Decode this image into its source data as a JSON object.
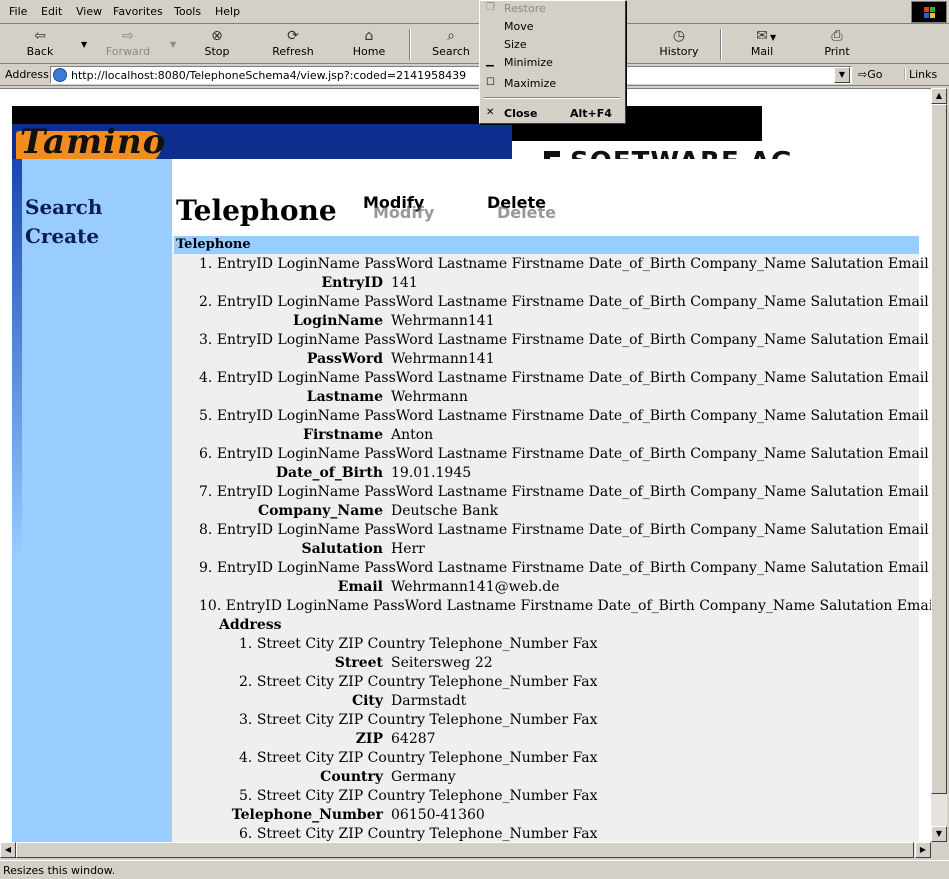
{
  "menubar": {
    "items": [
      "File",
      "Edit",
      "View",
      "Favorites",
      "Tools",
      "Help"
    ]
  },
  "toolbar": {
    "back": "Back",
    "forward": "Forward",
    "stop": "Stop",
    "refresh": "Refresh",
    "home": "Home",
    "search": "Search",
    "history": "History",
    "mail": "Mail",
    "print": "Print"
  },
  "address": {
    "label": "Address",
    "url": "http://localhost:8080/TelephoneSchema4/view.jsp?:coded=2141958439",
    "go": "Go",
    "links": "Links"
  },
  "system_menu": {
    "restore": "Restore",
    "move": "Move",
    "size": "Size",
    "minimize": "Minimize",
    "maximize": "Maximize",
    "close": "Close",
    "close_shortcut": "Alt+F4"
  },
  "page": {
    "logo_text": "Tamino",
    "brand_text": "SOFTWARE AG",
    "sidebar": {
      "search": "Search",
      "create": "Create"
    },
    "title": "Telephone",
    "actions": {
      "modify": "Modify",
      "delete": "Delete"
    },
    "section_label": "Telephone",
    "entries": [
      {
        "num": "1.",
        "header": "EntryID LoginName PassWord Lastname Firstname Date_of_Birth Company_Name Salutation Email Address",
        "label": "EntryID",
        "value": "141"
      },
      {
        "num": "2.",
        "header": "EntryID LoginName PassWord Lastname Firstname Date_of_Birth Company_Name Salutation Email Address",
        "label": "LoginName",
        "value": "Wehrmann141"
      },
      {
        "num": "3.",
        "header": "EntryID LoginName PassWord Lastname Firstname Date_of_Birth Company_Name Salutation Email Address",
        "label": "PassWord",
        "value": "Wehrmann141"
      },
      {
        "num": "4.",
        "header": "EntryID LoginName PassWord Lastname Firstname Date_of_Birth Company_Name Salutation Email Address",
        "label": "Lastname",
        "value": "Wehrmann"
      },
      {
        "num": "5.",
        "header": "EntryID LoginName PassWord Lastname Firstname Date_of_Birth Company_Name Salutation Email Address",
        "label": "Firstname",
        "value": "Anton"
      },
      {
        "num": "6.",
        "header": "EntryID LoginName PassWord Lastname Firstname Date_of_Birth Company_Name Salutation Email Address",
        "label": "Date_of_Birth",
        "value": "19.01.1945"
      },
      {
        "num": "7.",
        "header": "EntryID LoginName PassWord Lastname Firstname Date_of_Birth Company_Name Salutation Email Address",
        "label": "Company_Name",
        "value": "Deutsche Bank"
      },
      {
        "num": "8.",
        "header": "EntryID LoginName PassWord Lastname Firstname Date_of_Birth Company_Name Salutation Email Address",
        "label": "Salutation",
        "value": "Herr"
      },
      {
        "num": "9.",
        "header": "EntryID LoginName PassWord Lastname Firstname Date_of_Birth Company_Name Salutation Email Address",
        "label": "Email",
        "value": "Wehrmann141@web.de"
      },
      {
        "num": "10.",
        "header": "EntryID LoginName PassWord Lastname Firstname Date_of_Birth Company_Name Salutation Email Address",
        "label": "Address",
        "value": ""
      }
    ],
    "address_entries": [
      {
        "num": "1.",
        "header": "Street City ZIP Country Telephone_Number Fax",
        "label": "Street",
        "value": "Seitersweg 22"
      },
      {
        "num": "2.",
        "header": "Street City ZIP Country Telephone_Number Fax",
        "label": "City",
        "value": "Darmstadt"
      },
      {
        "num": "3.",
        "header": "Street City ZIP Country Telephone_Number Fax",
        "label": "ZIP",
        "value": "64287"
      },
      {
        "num": "4.",
        "header": "Street City ZIP Country Telephone_Number Fax",
        "label": "Country",
        "value": "Germany"
      },
      {
        "num": "5.",
        "header": "Street City ZIP Country Telephone_Number Fax",
        "label": "Telephone_Number",
        "value": "06150-41360"
      },
      {
        "num": "6.",
        "header": "Street City ZIP Country Telephone_Number Fax",
        "label": "",
        "value": ""
      }
    ]
  },
  "status": {
    "text": "Resizes this window."
  },
  "colors": {
    "sidebar": "#99ccff",
    "section_bar": "#99ccff",
    "content_bg": "#efefef",
    "logo_band": "#0e2e8f",
    "logo_orange": "#f28c1d"
  }
}
